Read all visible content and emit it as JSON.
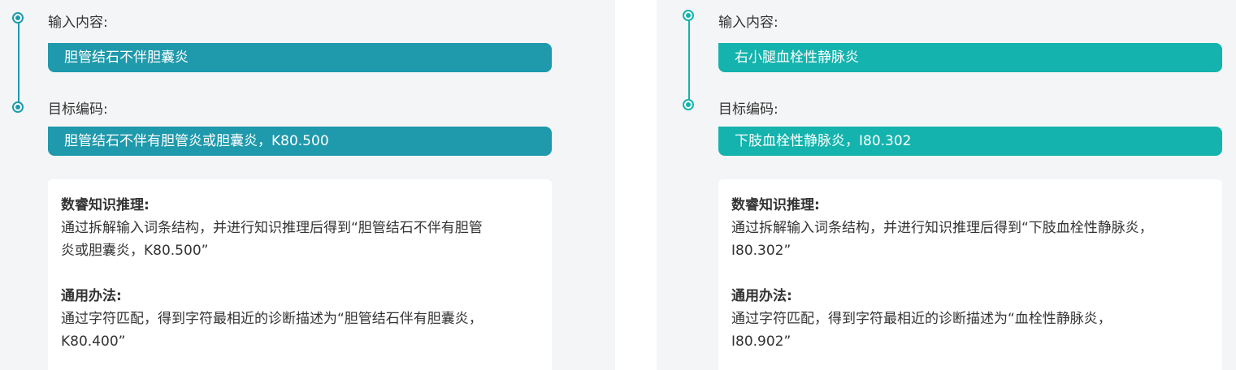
{
  "left": {
    "input_label": "输入内容:",
    "input_value": "胆管结石不伴胆囊炎",
    "target_label": "目标编码:",
    "target_value": "胆管结石不伴有胆管炎或胆囊炎，K80.500",
    "reasoning_title": "数睿知识推理:",
    "reasoning_line1": "通过拆解输入词条结构，并进行知识推理后得到“胆管结石不伴有胆管",
    "reasoning_line2": "炎或胆囊炎，K80.500”",
    "general_title": "通用办法:",
    "general_line1": "通过字符匹配，得到字符最相近的诊断描述为“胆管结石伴有胆囊炎，",
    "general_line2": "K80.400”"
  },
  "right": {
    "input_label": "输入内容:",
    "input_value": "右小腿血栓性静脉炎",
    "target_label": "目标编码:",
    "target_value": "下肢血栓性静脉炎，I80.302",
    "reasoning_title": "数睿知识推理:",
    "reasoning_line1": "通过拆解输入词条结构，并进行知识推理后得到“下肢血栓性静脉炎，",
    "reasoning_line2": "I80.302”",
    "general_title": "通用办法:",
    "general_line1": "通过字符匹配，得到字符最相近的诊断描述为“血栓性静脉炎，",
    "general_line2": "I80.902”"
  },
  "colors": {
    "left_accent": "#1f99ac",
    "right_accent": "#14b3ad",
    "panel_bg": "#f4f5f7",
    "text": "#333333"
  }
}
